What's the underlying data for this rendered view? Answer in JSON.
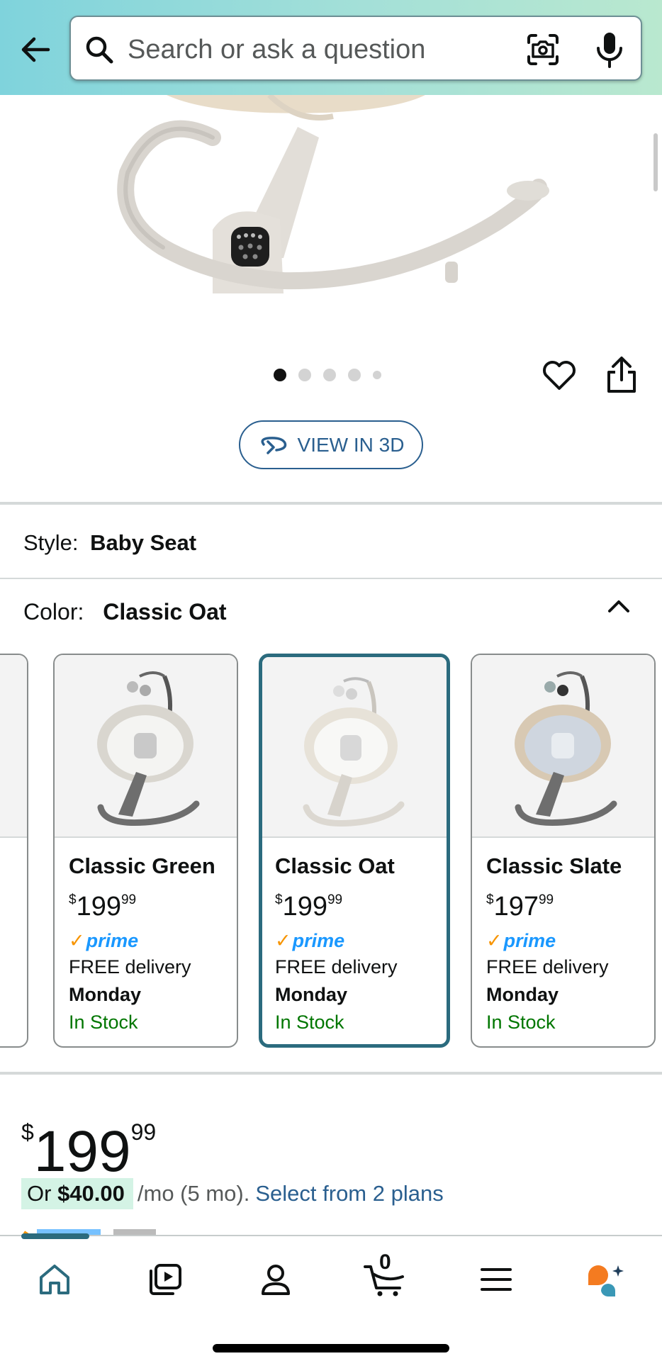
{
  "header": {
    "search_placeholder": "Search or ask a question"
  },
  "gallery": {
    "total_images": 5,
    "active_index": 0
  },
  "view_3d_label": "VIEW IN 3D",
  "style": {
    "label": "Style:",
    "value": "Baby Seat"
  },
  "color": {
    "label": "Color:",
    "value": "Classic Oat"
  },
  "swatches": [
    {
      "name": "Classic Green",
      "price_dollar": "$",
      "price_whole": "199",
      "price_cents": "99",
      "prime": "prime",
      "delivery": "FREE delivery",
      "day": "Monday",
      "stock": "In Stock",
      "tint": "#d9d6cf"
    },
    {
      "name": "Classic Oat",
      "price_dollar": "$",
      "price_whole": "199",
      "price_cents": "99",
      "prime": "prime",
      "delivery": "FREE delivery",
      "day": "Monday",
      "stock": "In Stock",
      "tint": "#e7e2d8"
    },
    {
      "name": "Classic Slate",
      "price_dollar": "$",
      "price_whole": "197",
      "price_cents": "99",
      "prime": "prime",
      "delivery": "FREE delivery",
      "day": "Monday",
      "stock": "In Stock",
      "tint": "#cfd6df"
    }
  ],
  "price": {
    "currency": "$",
    "whole": "199",
    "cents": "99"
  },
  "installment": {
    "prefix": "Or",
    "amount": "$40.00",
    "term": "/mo (5 mo).",
    "link": "Select from 2 plans"
  },
  "bottom_nav": {
    "cart_count": "0",
    "items": [
      "home-icon",
      "video-icon",
      "account-icon",
      "cart-icon",
      "menu-icon",
      "rufus-icon"
    ]
  },
  "colors": {
    "accent": "#2b6b7e",
    "link": "#2a5f8f",
    "in_stock": "#007600",
    "prime_blue": "#1a98ff",
    "prime_check": "#f79400"
  }
}
